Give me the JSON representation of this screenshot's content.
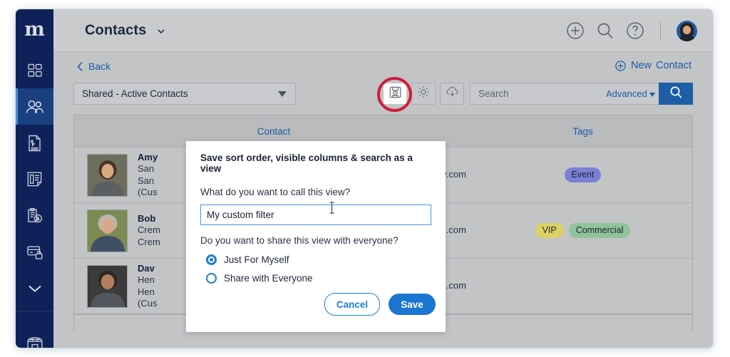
{
  "theme": {
    "sidebar_bg": "#0e2259",
    "sidebar_active": "#1b4080",
    "chrome_bg": "#c2c4c6",
    "header_bg": "#c9cbcd",
    "link_blue": "#1e5ba8",
    "primary_blue": "#1b76cf",
    "highlight_red": "#cc1f3c"
  },
  "sidebar": {
    "brand": "m",
    "items": [
      {
        "icon": "dashboard-grid-icon",
        "name": "dashboard",
        "active": false
      },
      {
        "icon": "contacts-people-icon",
        "name": "contacts",
        "active": true
      },
      {
        "icon": "invoice-document-icon",
        "name": "invoices",
        "active": false
      },
      {
        "icon": "estimates-list-icon",
        "name": "estimates",
        "active": false
      },
      {
        "icon": "clipboard-dollar-icon",
        "name": "payments",
        "active": false
      },
      {
        "icon": "card-lock-icon",
        "name": "secure-card",
        "active": false
      },
      {
        "icon": "chevron-down-icon",
        "name": "expand-more",
        "active": false
      },
      {
        "icon": "storefront-icon",
        "name": "marketplace",
        "active": false
      }
    ]
  },
  "header": {
    "title": "Contacts",
    "title_caret_icon": "chevron-down-icon",
    "actions": [
      {
        "icon": "plus-circle-icon",
        "name": "add"
      },
      {
        "icon": "search-icon",
        "name": "global-search"
      },
      {
        "icon": "help-circle-icon",
        "name": "help"
      }
    ],
    "avatar_name": "user-avatar"
  },
  "subbar": {
    "back_label": "Back",
    "back_icon": "chevron-left-icon",
    "new_icon": "plus-circle-icon",
    "new_label_1": "New",
    "new_label_2": "Contact"
  },
  "toolbar": {
    "view_select_value": "Shared - Active Contacts",
    "view_select_caret_icon": "caret-down-icon",
    "buttons": [
      {
        "icon": "save-view-floppy-icon",
        "name": "save-view",
        "active": true,
        "highlighted": true
      },
      {
        "icon": "gear-icon",
        "name": "column-settings",
        "active": false,
        "highlighted": false
      },
      {
        "icon": "cloud-download-icon",
        "name": "export-download",
        "active": false,
        "highlighted": false
      }
    ],
    "search_placeholder": "Search",
    "search_value": "",
    "advanced_label": "Advanced",
    "advanced_caret_icon": "caret-down-icon",
    "search_button_icon": "search-icon"
  },
  "table": {
    "columns": [
      "Contact",
      "Tags"
    ],
    "rows": [
      {
        "name": "Amy",
        "line2": "San",
        "line3": "San",
        "line4": "(Cus",
        "email_fragment": "dcompany.com",
        "tags": [
          {
            "label": "Event",
            "color": "#7b80d6"
          }
        ],
        "thumb": {
          "bg": "#6d6f5c",
          "hair": "#4b3323",
          "skin": "#d9a983",
          "shirt": "#5b5f62"
        }
      },
      {
        "name": "Bob",
        "line2": "Crem",
        "line3": "Crem",
        "line4": "",
        "email_fragment": "@gmail.com",
        "tags": [
          {
            "label": "VIP",
            "color": "#dcd263"
          },
          {
            "label": "Commercial",
            "color": "#90c49c"
          }
        ],
        "thumb": {
          "bg": "#7d8a52",
          "hair": "#b9b6ae",
          "skin": "#d7a98a",
          "shirt": "#3f4f63"
        }
      },
      {
        "name": "Dav",
        "line2": "Hen",
        "line3": "Hen",
        "line4": "(Cus",
        "email_fragment": "ndscaping.com",
        "tags": [],
        "thumb": {
          "bg": "#3b3b3b",
          "hair": "#2c2622",
          "skin": "#b07e5c",
          "shirt": "#52565c"
        }
      }
    ]
  },
  "modal": {
    "title": "Save sort order, visible columns & search as a view",
    "question_name": "What do you want to call this view?",
    "name_value": "My custom filter",
    "name_placeholder": "",
    "question_share": "Do you want to share this view with everyone?",
    "options": [
      {
        "label": "Just For Myself",
        "selected": true
      },
      {
        "label": "Share with Everyone",
        "selected": false
      }
    ],
    "cancel_label": "Cancel",
    "save_label": "Save",
    "cursor_icon": "text-cursor-icon"
  }
}
